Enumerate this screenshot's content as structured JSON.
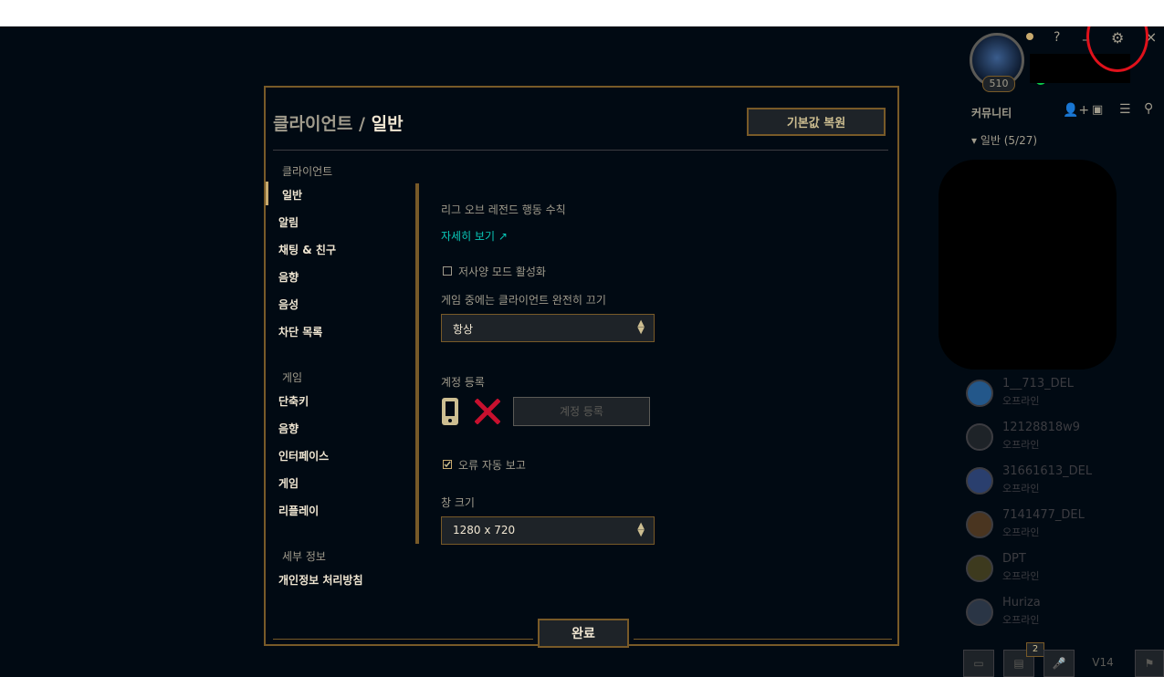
{
  "header": {
    "help_label": "?",
    "minimize_label": "_",
    "close_label": "×",
    "settings_icon": "gear-icon",
    "profile": {
      "level": "510"
    }
  },
  "modal": {
    "title_parent": "클라이언트",
    "title_sep": "/",
    "title_current": "일반",
    "restore_defaults_label": "기본값 복원",
    "done_label": "완료"
  },
  "nav": {
    "groups": [
      {
        "label": "클라이언트",
        "items": [
          "일반",
          "알림",
          "채팅 & 친구",
          "음향",
          "음성",
          "차단 목록"
        ]
      },
      {
        "label": "게임",
        "items": [
          "단축키",
          "음향",
          "인터페이스",
          "게임",
          "리플레이"
        ]
      },
      {
        "label": "세부 정보",
        "items": [
          "개인정보 처리방침"
        ]
      }
    ],
    "active": "일반"
  },
  "content": {
    "code_of_conduct": "리그 오브 레전드 행동 수칙",
    "view_details_link": "자세히 보기 ↗",
    "low_spec_mode": {
      "label": "저사양 모드 활성화",
      "checked": false
    },
    "close_client_label": "게임 중에는 클라이언트 완전히 끄기",
    "close_client_value": "항상",
    "account_register_label": "계정 등록",
    "account_register_button": "계정 등록",
    "auto_error_report": {
      "label": "오류 자동 보고",
      "checked": true
    },
    "window_size_label": "창 크기",
    "window_size_value": "1280 x 720"
  },
  "social": {
    "header_label": "커뮤니티",
    "group_label": "일반 (5/27)",
    "friends": [
      {
        "name": "1__713_DEL",
        "status": "오프라인"
      },
      {
        "name": "12128818w9",
        "status": "오프라인"
      },
      {
        "name": "31661613_DEL",
        "status": "오프라인"
      },
      {
        "name": "7141477_DEL",
        "status": "오프라인"
      },
      {
        "name": "DPT",
        "status": "오프라인"
      },
      {
        "name": "Huriza",
        "status": "오프라인"
      }
    ]
  },
  "footer": {
    "notification_count": "2",
    "version_label": "V14"
  },
  "colors": {
    "background": "#010a13",
    "gold": "#785a28",
    "gold_light": "#c8aa6e",
    "text": "#a09b8c",
    "text_bright": "#f0e6d2",
    "link": "#0ac8b9",
    "annotation": "#e0111b"
  }
}
